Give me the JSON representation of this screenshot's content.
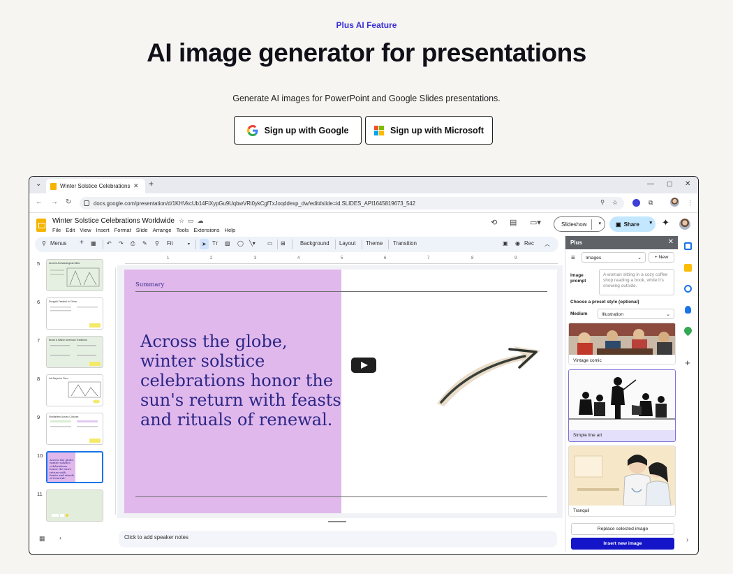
{
  "hero": {
    "eyebrow": "Plus AI Feature",
    "title": "AI image generator for presentations",
    "subtitle": "Generate AI images for PowerPoint and Google Slides presentations.",
    "google_btn": "Sign up with Google",
    "microsoft_btn": "Sign up with Microsoft"
  },
  "browser": {
    "tab_title": "Winter Solstice Celebrations W",
    "url": "docs.google.com/presentation/d/1KHVkcUb14FiXypGu9UqbwVRi0ykCgfTxJoqddexp_dw/edit#slide=id.SLIDES_API1645819673_542"
  },
  "doc": {
    "title": "Winter Solstice Celebrations Worldwide",
    "menus": [
      "File",
      "Edit",
      "View",
      "Insert",
      "Format",
      "Slide",
      "Arrange",
      "Tools",
      "Extensions",
      "Help"
    ],
    "slideshow_label": "Slideshow",
    "share_label": "Share"
  },
  "toolbar": {
    "menus_label": "Menus",
    "zoom_label": "Fit",
    "background": "Background",
    "layout": "Layout",
    "theme": "Theme",
    "transition": "Transition",
    "rec": "Rec"
  },
  "thumbnails": [
    {
      "num": "5",
      "title": "Ancient Archaeological Sites"
    },
    {
      "num": "6",
      "title": "Dongzhi Festival in China"
    },
    {
      "num": "7",
      "title": "Brazil & Native American Traditions"
    },
    {
      "num": "8",
      "title": "Inti Raymi in Peru"
    },
    {
      "num": "9",
      "title": "Similarities Across Cultures"
    },
    {
      "num": "10",
      "title": "Across the globe, winter solstice celebrations honor the sun's return with feasts and rituals of renewal."
    },
    {
      "num": "11",
      "title": ""
    }
  ],
  "ruler": [
    "1",
    "2",
    "3",
    "4",
    "5",
    "6",
    "7",
    "8",
    "9"
  ],
  "slide": {
    "label": "Summary",
    "quote": "Across the globe, winter solstice celebrations honor the sun's return with feasts and rituals of renewal."
  },
  "notes_placeholder": "Click to add speaker notes",
  "plus_panel": {
    "title": "Plus",
    "mode": "Images",
    "new_label": "New",
    "prompt_label": "Image prompt",
    "prompt_placeholder": "A woman sitting in a cozy coffee shop reading a book, while it's snowing outside.",
    "preset_heading": "Choose a preset style (optional)",
    "medium_label": "Medium",
    "medium_value": "Illustration",
    "styles": [
      "Vintage comic",
      "Simple line art",
      "Tranquil"
    ],
    "replace_label": "Replace selected image",
    "insert_label": "Insert new image"
  },
  "colors": {
    "accent": "#3b2fd6",
    "slide_bg": "#e0b8ec",
    "slide_text": "#2b2685",
    "insert_button": "#1414c8"
  }
}
